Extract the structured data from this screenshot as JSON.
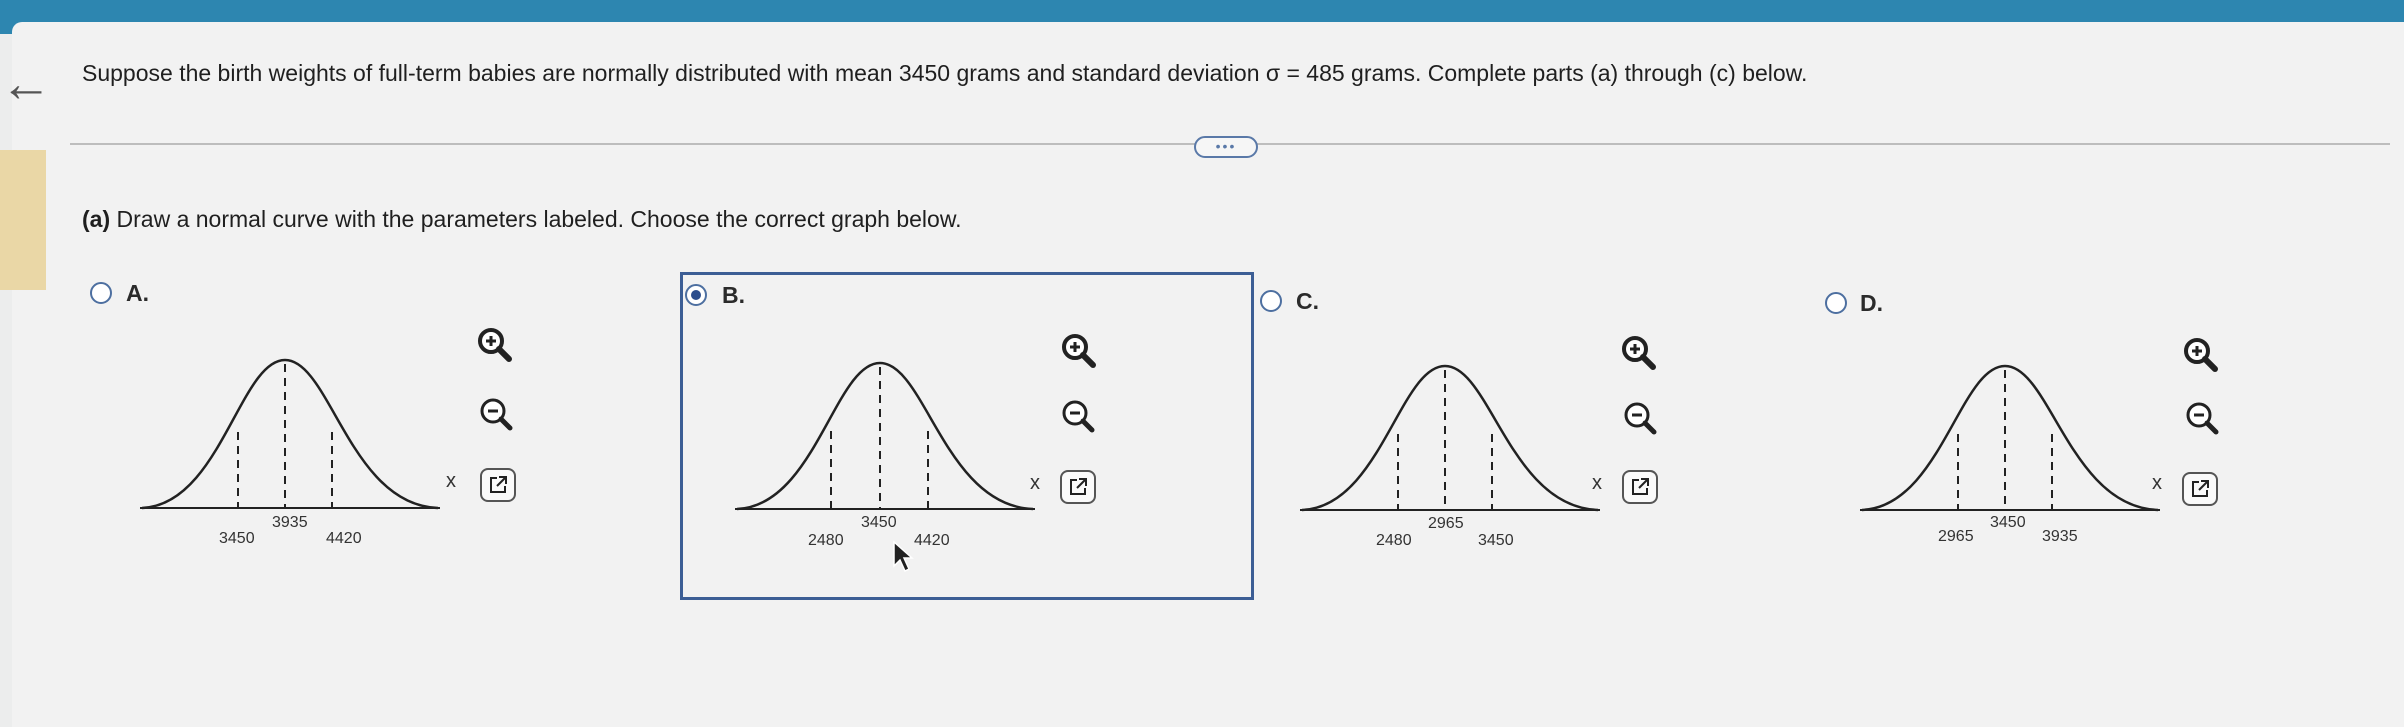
{
  "question": {
    "before_sigma": "Suppose the birth weights of full-term babies are normally distributed with mean 3450 grams and standard deviation ",
    "sigma_symbol": "σ",
    "after_sigma": " = 485 grams. Complete parts (a) through (c) below."
  },
  "more_button": "•••",
  "part_a": {
    "prefix": "(a)",
    "text": " Draw a normal curve with the parameters labeled. Choose the correct graph below."
  },
  "axis_label": "x",
  "options": [
    {
      "label": "A.",
      "selected": false,
      "ticks": {
        "left": "3450",
        "mid": "3935",
        "right": "4420"
      }
    },
    {
      "label": "B.",
      "selected": true,
      "ticks": {
        "left": "2480",
        "mid": "3450",
        "right": "4420"
      }
    },
    {
      "label": "C.",
      "selected": false,
      "ticks": {
        "left": "2480",
        "mid": "2965",
        "right": "3450"
      }
    },
    {
      "label": "D.",
      "selected": false,
      "ticks": {
        "left": "2965",
        "mid": "3450",
        "right": "3935"
      }
    }
  ],
  "icons": {
    "zoom_in": "zoom-in-icon",
    "zoom_out": "zoom-out-icon",
    "external": "external-link-icon",
    "back": "back-arrow-icon"
  },
  "colors": {
    "header": "#2d86b0",
    "selection_border": "#3c5e95",
    "radio": "#2b4d8c"
  }
}
